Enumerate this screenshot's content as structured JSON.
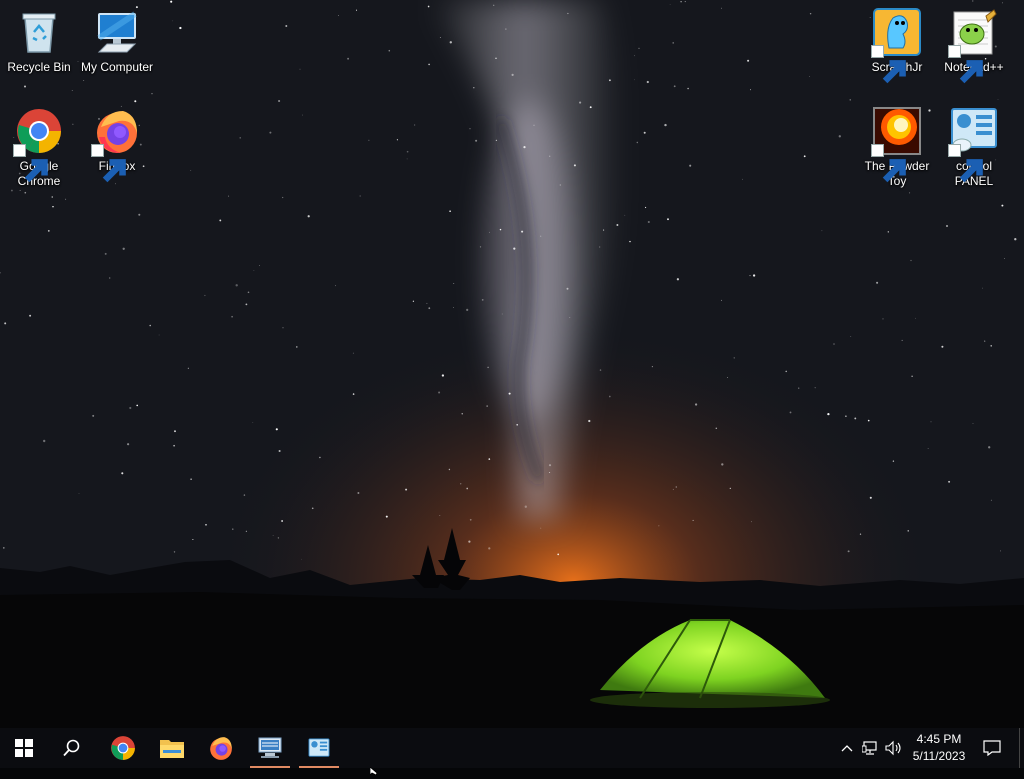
{
  "desktop": {
    "icons": [
      {
        "id": "recycle-bin",
        "label": "Recycle Bin",
        "icon": "recycle-bin-icon"
      },
      {
        "id": "my-computer",
        "label": "My Computer",
        "icon": "computer-icon"
      },
      {
        "id": "google-chrome",
        "label": "Google\nChrome",
        "icon": "chrome-icon"
      },
      {
        "id": "firefox",
        "label": "Firefox",
        "icon": "firefox-icon"
      },
      {
        "id": "scratchjr",
        "label": "ScratchJr",
        "icon": "scratchjr-icon"
      },
      {
        "id": "notepad-plus-plus",
        "label": "Notepad++",
        "icon": "notepad-plus-plus-icon"
      },
      {
        "id": "the-powder-toy",
        "label": "The Powder\nToy",
        "icon": "powder-toy-icon"
      },
      {
        "id": "control-panel",
        "label": "control\nPANEL",
        "icon": "control-panel-icon"
      }
    ]
  },
  "taskbar": {
    "pinned": [
      {
        "id": "start",
        "icon": "windows-start-icon"
      },
      {
        "id": "search",
        "icon": "search-icon"
      },
      {
        "id": "chrome",
        "icon": "chrome-icon"
      },
      {
        "id": "file-explorer",
        "icon": "folder-icon"
      },
      {
        "id": "firefox",
        "icon": "firefox-icon"
      },
      {
        "id": "remote-app",
        "icon": "remote-desktop-icon"
      },
      {
        "id": "control-panel",
        "icon": "control-panel-icon"
      }
    ],
    "tray": {
      "time": "4:45 PM",
      "date": "5/11/2023"
    }
  },
  "colors": {
    "taskbar_bg": "#0b0c10",
    "running_indicator": "#e08a63",
    "tent_green": "#7ed321"
  }
}
